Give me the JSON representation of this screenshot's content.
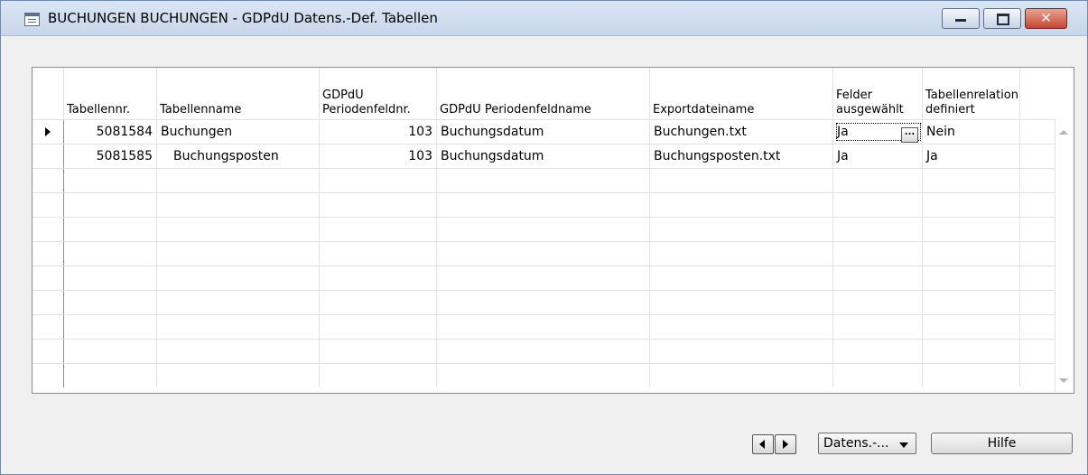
{
  "window": {
    "title": "BUCHUNGEN BUCHUNGEN - GDPdU Datens.-Def. Tabellen",
    "close_glyph": "✕"
  },
  "table": {
    "headers": [
      "Tabellennr.",
      "Tabellenname",
      "GDPdU Periodenfeldnr.",
      "GDPdU Periodenfeldname",
      "Exportdateiname",
      "Felder ausgewählt",
      "Tabellenrelation definiert"
    ],
    "rows": [
      [
        "5081584",
        "Buchungen",
        "103",
        "Buchungsdatum",
        "Buchungen.txt",
        "Ja",
        "Nein"
      ],
      [
        "5081585",
        "Buchungsposten",
        "103",
        "Buchungsdatum",
        "Buchungsposten.txt",
        "Ja",
        "Ja"
      ]
    ],
    "ellipsis": "..."
  },
  "footer": {
    "datens_label": "Datens.-...",
    "help_label": "Hilfe"
  },
  "icons": [
    "table-icon",
    "minimize-icon",
    "maximize-icon",
    "close-icon",
    "row-pointer-icon",
    "scroll-up-icon",
    "scroll-down-icon",
    "nav-left-icon",
    "nav-right-icon",
    "dropdown-caret-icon"
  ]
}
